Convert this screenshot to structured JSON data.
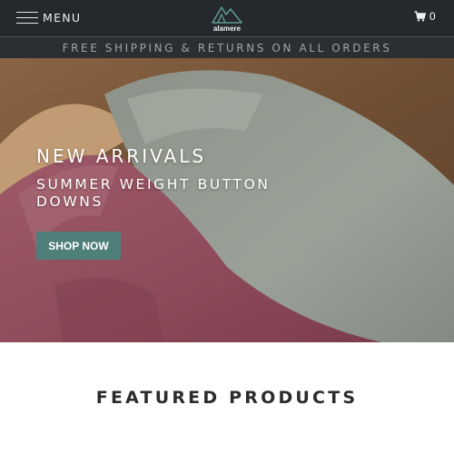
{
  "header": {
    "menu_label": "MENU",
    "logo_text": "alamere",
    "cart_count": "0"
  },
  "announcement": {
    "text": "FREE SHIPPING & RETURNS ON ALL ORDERS"
  },
  "hero": {
    "title": "NEW ARRIVALS",
    "subtitle": "SUMMER WEIGHT BUTTON DOWNS",
    "cta_label": "SHOP NOW",
    "cta_color": "#4f7f7b"
  },
  "featured": {
    "title": "FEATURED PRODUCTS"
  },
  "colors": {
    "header_bg": "#25282c",
    "announcement_bg": "#2b2f33",
    "announcement_text": "#9ea3a8",
    "page_bg": "#ffffff"
  },
  "icons": {
    "menu": "hamburger-icon",
    "cart": "cart-icon",
    "logo": "mountain-logo"
  }
}
